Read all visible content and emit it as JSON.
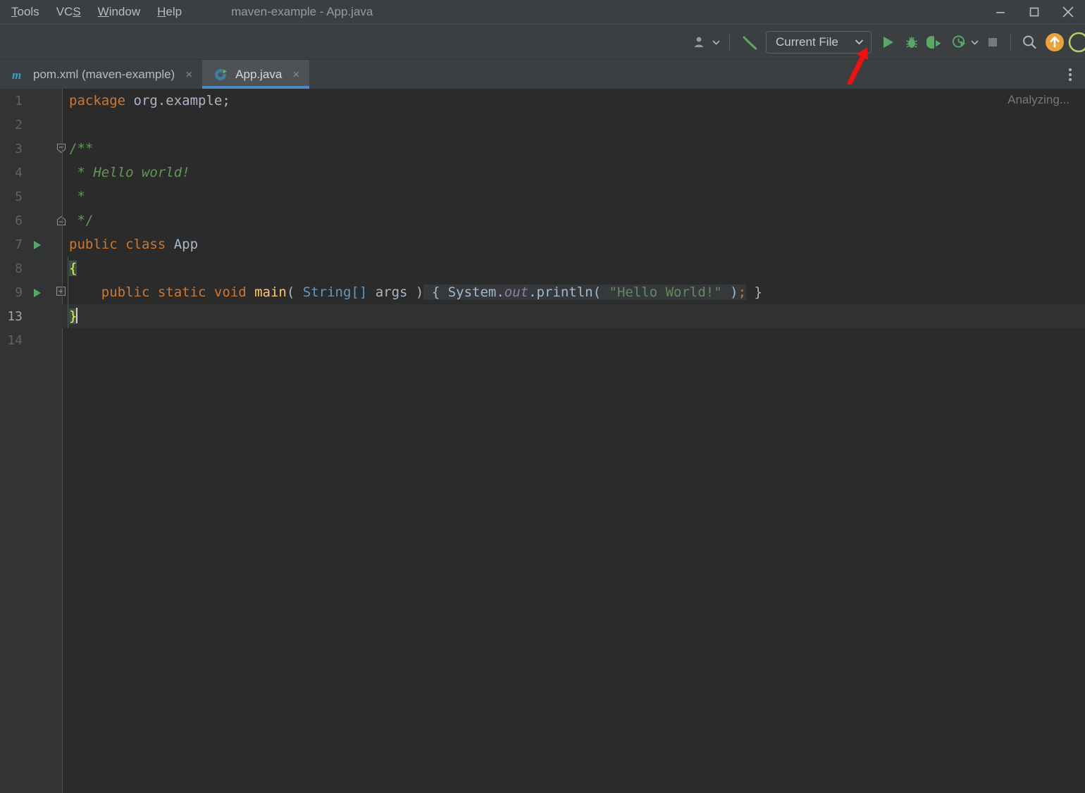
{
  "window": {
    "title": "maven-example - App.java",
    "controls": [
      {
        "name": "minimize-button",
        "glyph": "minimize"
      },
      {
        "name": "maximize-button",
        "glyph": "maximize"
      },
      {
        "name": "close-button",
        "glyph": "close"
      }
    ]
  },
  "menubar": {
    "items": [
      {
        "label": "Tools",
        "mnemonic": "T",
        "rest": "ools"
      },
      {
        "label": "VCS",
        "pre": "VC",
        "mnemonic": "S",
        "rest": ""
      },
      {
        "label": "Window",
        "mnemonic": "W",
        "rest": "indow"
      },
      {
        "label": "Help",
        "mnemonic": "H",
        "rest": "elp"
      }
    ]
  },
  "toolbar": {
    "account_icon": "user-icon",
    "build_icon": "hammer-icon",
    "run_config": {
      "label": "Current File",
      "caret": "chevron-down-icon"
    },
    "run_icon": "run-play-icon",
    "debug_icon": "debug-bug-icon",
    "coverage_icon": "run-with-coverage-icon",
    "profiler_icon": "profiler-icon",
    "stop_icon": "stop-square-icon",
    "search_icon": "search-icon",
    "update_icon": "update-arrow-up-icon"
  },
  "tabs": [
    {
      "name": "tab-pom-xml",
      "label": "pom.xml (maven-example)",
      "icon": "maven-m-icon",
      "active": false,
      "close": "×"
    },
    {
      "name": "tab-app-java",
      "label": "App.java",
      "icon": "java-runnable-class-icon",
      "active": true,
      "close": "×"
    }
  ],
  "tabbar": {
    "menu_icon": "more-options-icon"
  },
  "editor": {
    "status": "Analyzing...",
    "current_line": "13",
    "lines": [
      {
        "num": "1",
        "runnable": false,
        "fold": "",
        "current": false
      },
      {
        "num": "2",
        "runnable": false,
        "fold": "",
        "current": false
      },
      {
        "num": "3",
        "runnable": false,
        "fold": "collapse-top",
        "current": false
      },
      {
        "num": "4",
        "runnable": false,
        "fold": "",
        "current": false
      },
      {
        "num": "5",
        "runnable": false,
        "fold": "",
        "current": false
      },
      {
        "num": "6",
        "runnable": false,
        "fold": "collapse-bottom",
        "current": false
      },
      {
        "num": "7",
        "runnable": true,
        "fold": "",
        "current": false
      },
      {
        "num": "8",
        "runnable": false,
        "fold": "",
        "current": false
      },
      {
        "num": "9",
        "runnable": true,
        "fold": "expand",
        "current": false
      },
      {
        "num": "13",
        "runnable": false,
        "fold": "",
        "current": true
      },
      {
        "num": "14",
        "runnable": false,
        "fold": "",
        "current": false
      }
    ],
    "code": {
      "l1_kw": "package",
      "l1_pkg": " org.example;",
      "l3": "/**",
      "l4": " * Hello world!",
      "l5": " *",
      "l6": " */",
      "l7_kw1": "public",
      "l7_kw2": " class",
      "l7_name": " App",
      "l8_brace": "{",
      "l9_kw1": "    public",
      "l9_kw2": " static",
      "l9_kw3": " void",
      "l9_fn": " main",
      "l9_paren1": "( ",
      "l9_type": "String[]",
      "l9_arg": " args",
      "l9_paren2": " )",
      "l9_fold_open": " { ",
      "l9_sysout": "System.",
      "l9_out": "out",
      "l9_println": ".println",
      "l9_lparen": "( ",
      "l9_string": "\"Hello World!\"",
      "l9_rparen": " )",
      "l9_semi": ";",
      "l9_fold_close": " }",
      "l13_brace": "}"
    }
  },
  "annotation": {
    "arrow": "red-pointer-arrow",
    "color": "#ee1111",
    "points_at": "run-play-icon"
  },
  "colors": {
    "titlebar_bg": "#3c3f41",
    "editor_bg": "#2b2b2b",
    "gutter_bg": "#313335",
    "tab_active_bg": "#4e5254",
    "tab_underline": "#4a88c7",
    "run_green": "#59a869",
    "keyword_orange": "#cc7832",
    "string_green": "#6a8759",
    "comment_green": "#629755",
    "method_yellow": "#ffc66d",
    "field_purple": "#9876aa",
    "update_orange": "#e8a33d"
  }
}
